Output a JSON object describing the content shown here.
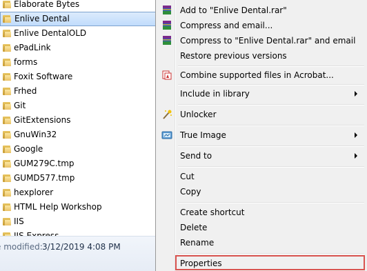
{
  "folders": [
    "Elaborate Bytes",
    "Enlive Dental",
    "Enlive DentalOLD",
    "ePadLink",
    "forms",
    "Foxit Software",
    "Frhed",
    "Git",
    "GitExtensions",
    "GnuWin32",
    "Google",
    "GUM279C.tmp",
    "GUMD577.tmp",
    "hexplorer",
    "HTML Help Workshop",
    "IIS",
    "IIS Express"
  ],
  "selected_folder": "Enlive Dental",
  "details": {
    "modified_label": "e modified:",
    "modified_value": "3/12/2019 4:08 PM"
  },
  "menu": {
    "add_to_archive": "Add to \"Enlive Dental.rar\"",
    "compress_email": "Compress and email...",
    "compress_to_email": "Compress to \"Enlive Dental.rar\" and email",
    "restore_versions": "Restore previous versions",
    "combine_acrobat": "Combine supported files in Acrobat...",
    "include_library": "Include in library",
    "unlocker": "Unlocker",
    "true_image": "True Image",
    "send_to": "Send to",
    "cut": "Cut",
    "copy": "Copy",
    "create_shortcut": "Create shortcut",
    "delete": "Delete",
    "rename": "Rename",
    "properties": "Properties"
  },
  "icons": {
    "winrar": "winrar-icon",
    "acrobat": "acrobat-icon",
    "unlocker": "wand-icon",
    "true_image": "true-image-icon",
    "folder": "folder-icon"
  },
  "colors": {
    "selection_bg": "#c1dcfc",
    "selection_border": "#7da2ce",
    "menu_bg": "#f0f0f0",
    "highlight_box": "#d9534f"
  }
}
